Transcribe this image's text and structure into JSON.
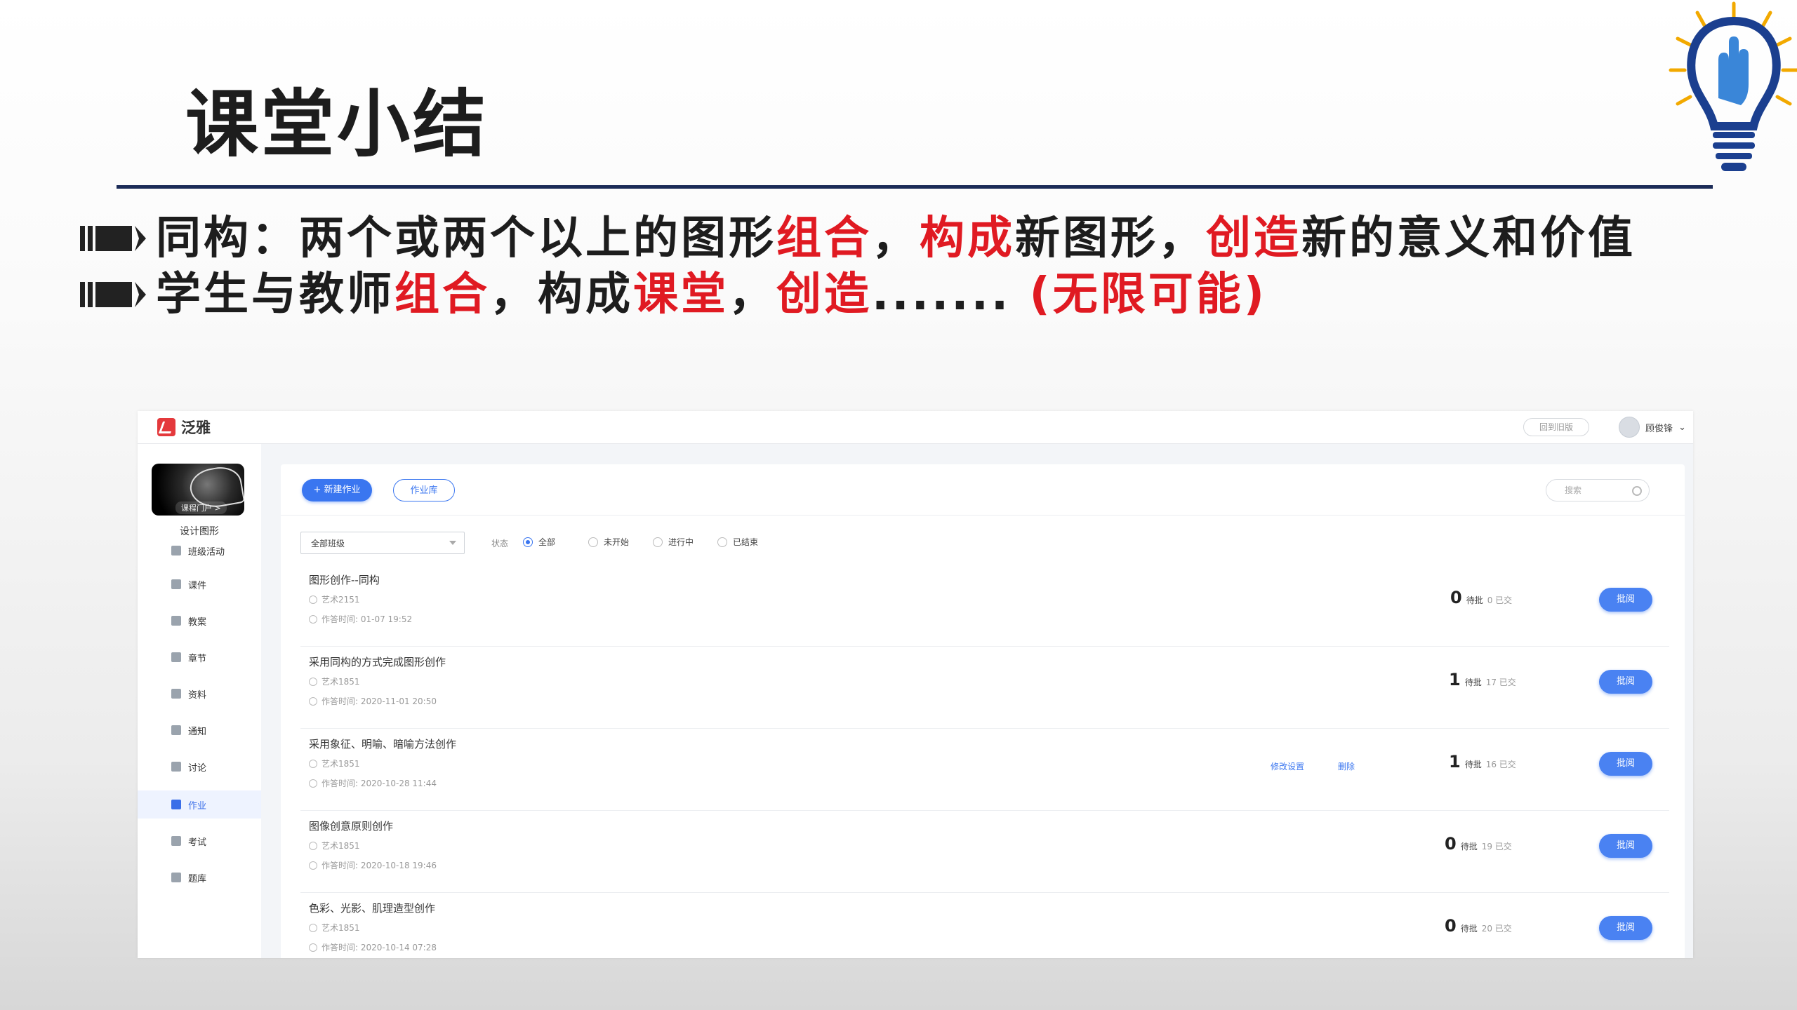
{
  "slide": {
    "title": "课堂小结",
    "bullets": [
      {
        "segments": [
          {
            "text": "同构：两个或两个以上的图形",
            "red": false
          },
          {
            "text": "组合",
            "red": true
          },
          {
            "text": "，",
            "red": false
          },
          {
            "text": "构成",
            "red": true
          },
          {
            "text": "新图形，",
            "red": false
          },
          {
            "text": "创造",
            "red": true
          },
          {
            "text": "新的意义和价值",
            "red": false
          }
        ]
      },
      {
        "segments": [
          {
            "text": "学生与教师",
            "red": false
          },
          {
            "text": "组合",
            "red": true
          },
          {
            "text": "，构成",
            "red": false
          },
          {
            "text": "课堂",
            "red": true
          },
          {
            "text": "，",
            "red": false
          },
          {
            "text": "创造",
            "red": true
          },
          {
            "text": "....... ",
            "red": false
          },
          {
            "text": "(无限可能)",
            "red": true
          }
        ]
      }
    ],
    "colors": {
      "accent_red": "#e01a22",
      "title_rule": "#1b2b57",
      "bulb_yellow": "#f2a900",
      "bulb_blue": "#1b3f8f"
    }
  },
  "lms": {
    "brand": "泛雅",
    "back_old": "回到旧版",
    "user_name": "顾俊锋",
    "course": {
      "portal": "课程门户 >",
      "name": "设计图形"
    },
    "sidebar": [
      {
        "label": "班级活动",
        "icon": "grid-icon",
        "active": false
      },
      {
        "label": "课件",
        "icon": "file-icon",
        "active": false
      },
      {
        "label": "教案",
        "icon": "doc-icon",
        "active": false
      },
      {
        "label": "章节",
        "icon": "book-icon",
        "active": false
      },
      {
        "label": "资料",
        "icon": "folder-icon",
        "active": false
      },
      {
        "label": "通知",
        "icon": "speaker-icon",
        "active": false
      },
      {
        "label": "讨论",
        "icon": "chat-icon",
        "active": false
      },
      {
        "label": "作业",
        "icon": "edit-icon",
        "active": true
      },
      {
        "label": "考试",
        "icon": "exam-icon",
        "active": false
      },
      {
        "label": "题库",
        "icon": "layers-icon",
        "active": false
      }
    ],
    "toolbar": {
      "new_homework": "+ 新建作业",
      "homework_library": "作业库",
      "search_placeholder": "搜索"
    },
    "filters": {
      "class_select": "全部班级",
      "status_label": "状态",
      "options": [
        {
          "label": "全部",
          "selected": true
        },
        {
          "label": "未开始",
          "selected": false
        },
        {
          "label": "进行中",
          "selected": false
        },
        {
          "label": "已结束",
          "selected": false
        }
      ]
    },
    "homeworks": [
      {
        "title": "图形创作--同构",
        "class": "艺术2151",
        "time": "作答时间: 01-07 19:52",
        "pending": "0",
        "pending_label": "待批",
        "submitted": "0 已交",
        "mark": "批阅",
        "actions": []
      },
      {
        "title": "采用同构的方式完成图形创作",
        "class": "艺术1851",
        "time": "作答时间: 2020-11-01 20:50",
        "pending": "1",
        "pending_label": "待批",
        "submitted": "17 已交",
        "mark": "批阅",
        "actions": []
      },
      {
        "title": "采用象征、明喻、暗喻方法创作",
        "class": "艺术1851",
        "time": "作答时间: 2020-10-28 11:44",
        "pending": "1",
        "pending_label": "待批",
        "submitted": "16 已交",
        "mark": "批阅",
        "actions": [
          "修改设置",
          "删除"
        ]
      },
      {
        "title": "图像创意原则创作",
        "class": "艺术1851",
        "time": "作答时间: 2020-10-18 19:46",
        "pending": "0",
        "pending_label": "待批",
        "submitted": "19 已交",
        "mark": "批阅",
        "actions": []
      },
      {
        "title": "色彩、光影、肌理造型创作",
        "class": "艺术1851",
        "time": "作答时间: 2020-10-14 07:28",
        "pending": "0",
        "pending_label": "待批",
        "submitted": "20 已交",
        "mark": "批阅",
        "actions": []
      }
    ]
  }
}
